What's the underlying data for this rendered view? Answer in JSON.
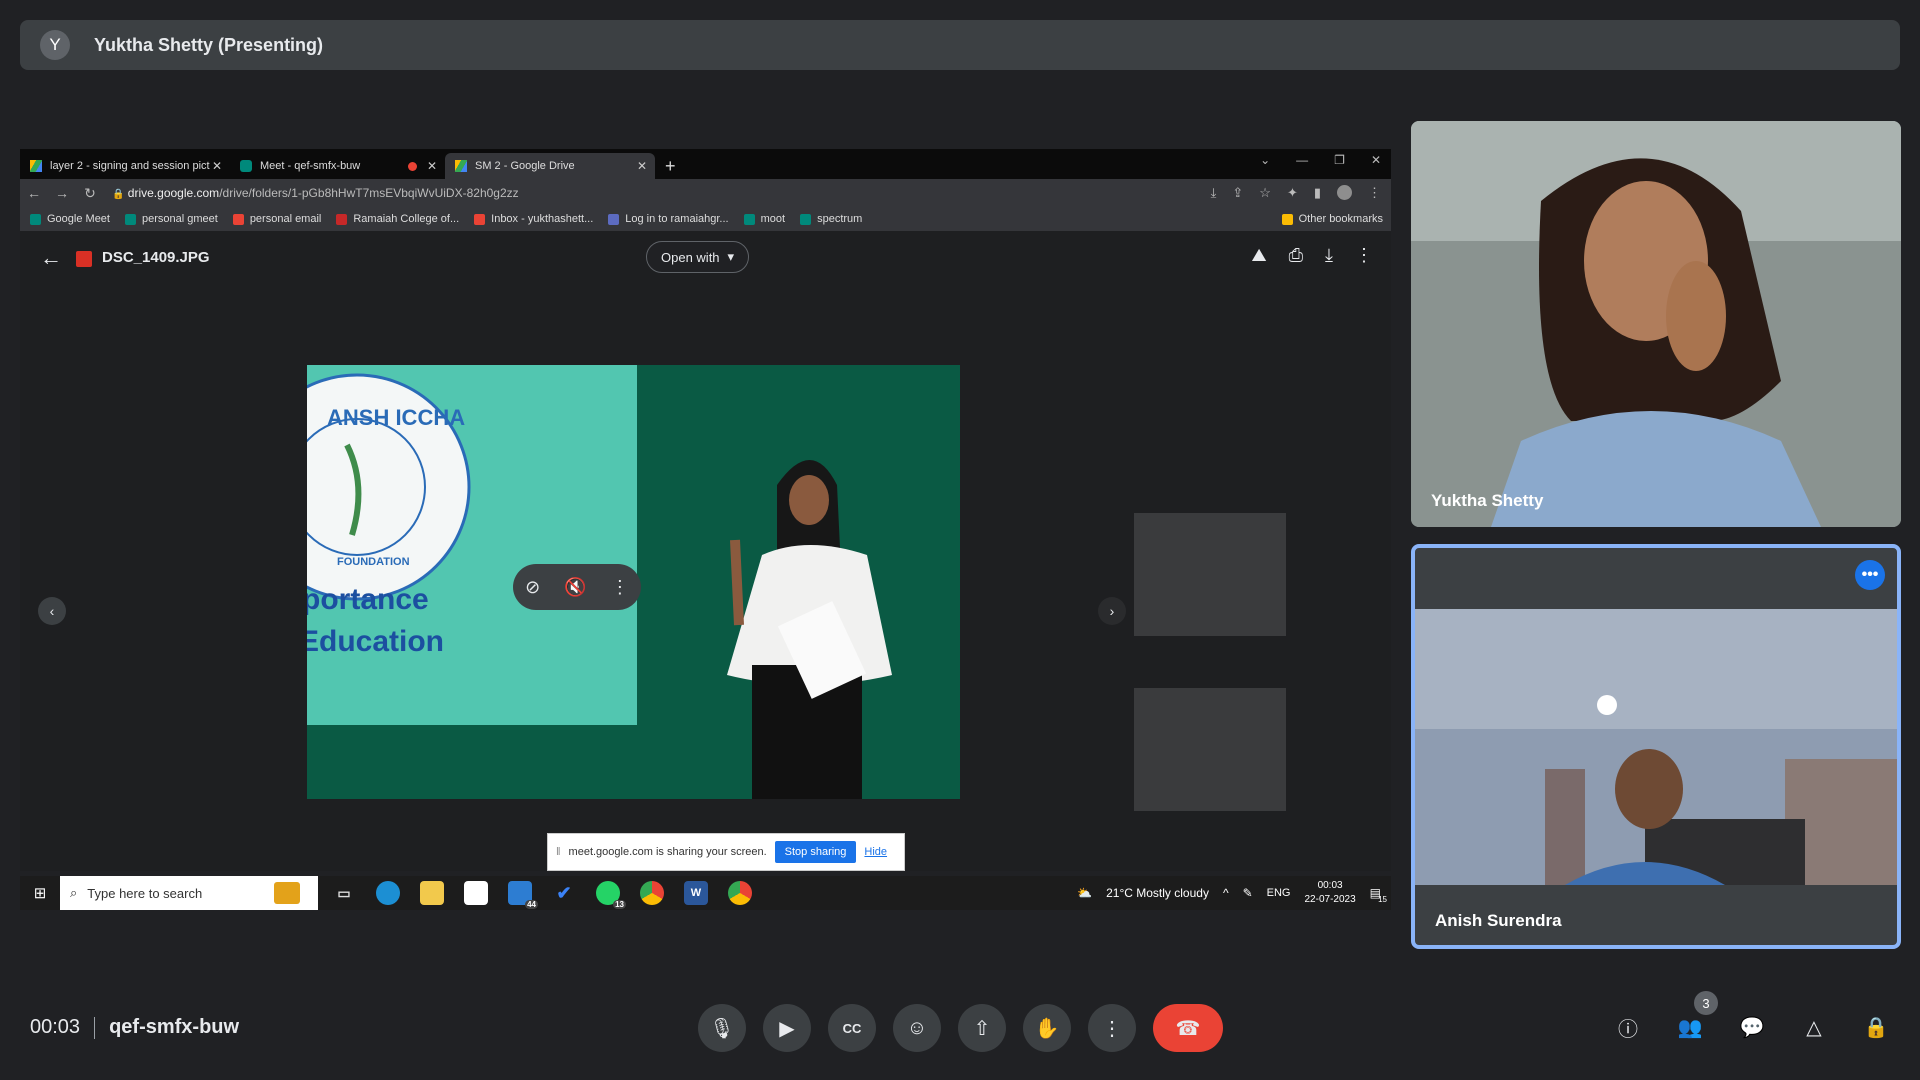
{
  "presenter": {
    "avatar_initial": "Y",
    "label": "Yuktha Shetty (Presenting)"
  },
  "browser": {
    "tabs": [
      {
        "title": "layer 2 - signing and session pict"
      },
      {
        "title": "Meet - qef-smfx-buw"
      },
      {
        "title": "SM 2 - Google Drive"
      }
    ],
    "url_host": "drive.google.com",
    "url_path": "/drive/folders/1-pGb8hHwT7msEVbqiWvUiDX-82h0g2zz",
    "bookmarks": [
      "Google Meet",
      "personal gmeet",
      "personal email",
      "Ramaiah College of...",
      "Inbox - yukthashett...",
      "Log in to ramaiahgr...",
      "moot",
      "spectrum"
    ],
    "other_bookmarks": "Other bookmarks"
  },
  "viewer": {
    "file_name": "DSC_1409.JPG",
    "open_with": "Open with",
    "photo_banner_line1": "portance",
    "photo_banner_line2": "Education",
    "logo_text": "ANSH ICCHA",
    "logo_sub": "FOUNDATION"
  },
  "share_bar": {
    "message": "meet.google.com is sharing your screen.",
    "stop": "Stop sharing",
    "hide": "Hide"
  },
  "taskbar": {
    "search_placeholder": "Type here to search",
    "mail_count": "44",
    "whatsapp_count": "13",
    "weather": "21°C  Mostly cloudy",
    "lang": "ENG",
    "time": "00:03",
    "date": "22-07-2023",
    "notif_count": "15"
  },
  "participants": [
    {
      "name": "Yuktha Shetty"
    },
    {
      "name": "Anish Surendra"
    }
  ],
  "meeting": {
    "time": "00:03",
    "code": "qef-smfx-buw",
    "people_count": "3"
  },
  "colors": {
    "accent": "#8ab4f8",
    "end_call": "#ea4335",
    "stop_sharing": "#1a73e8"
  }
}
